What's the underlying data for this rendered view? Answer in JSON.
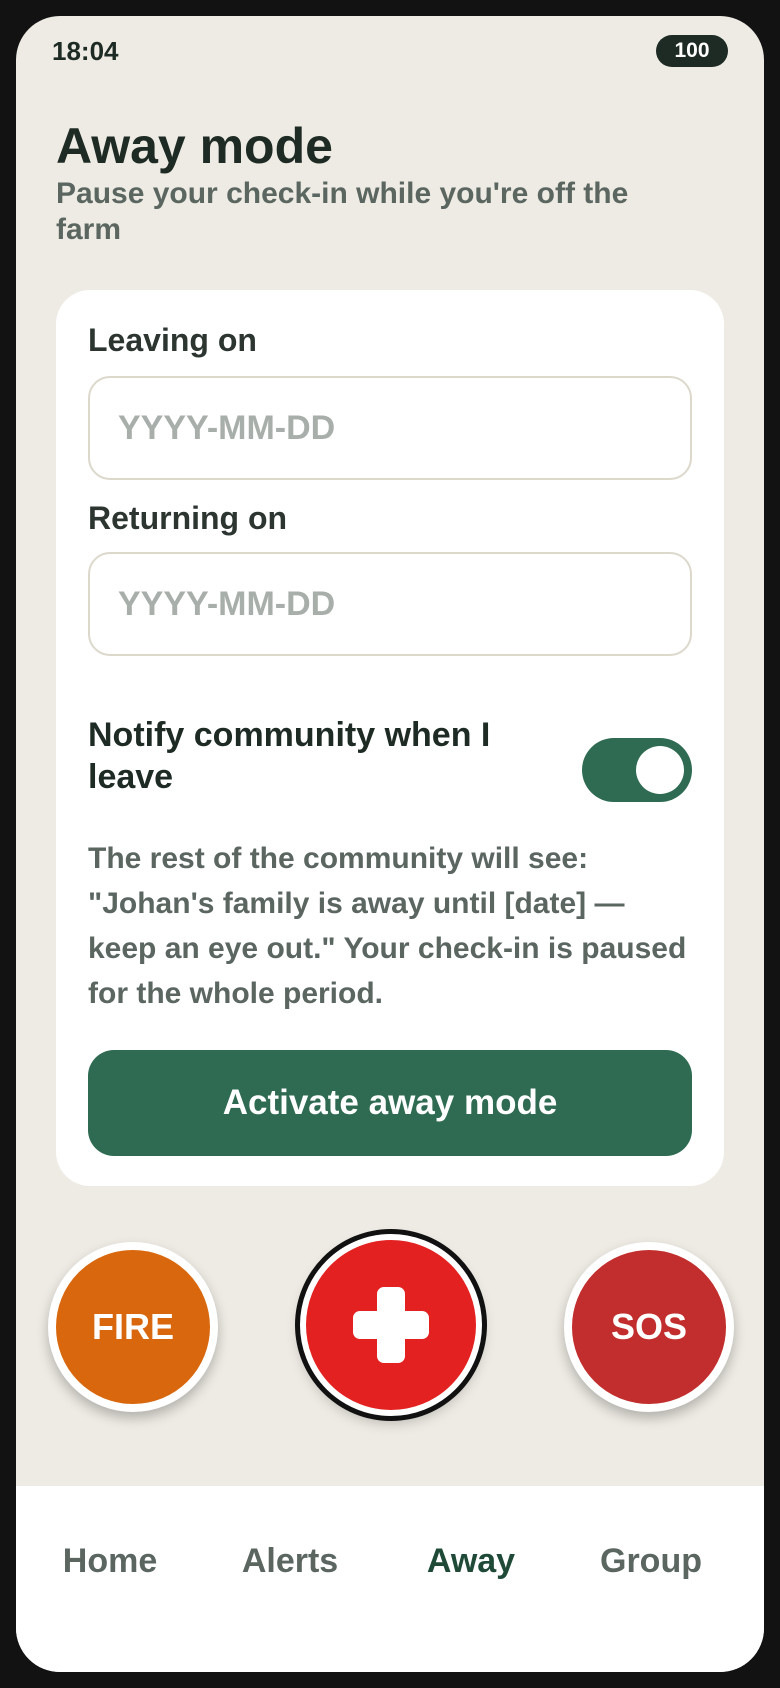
{
  "status_bar": {
    "time": "18:04",
    "battery": "100"
  },
  "header": {
    "title": "Away mode",
    "subtitle": "Pause your check-in while you're off the farm"
  },
  "form": {
    "leaving_label": "Leaving on",
    "leaving_placeholder": "YYYY-MM-DD",
    "leaving_value": "",
    "returning_label": "Returning on",
    "returning_placeholder": "YYYY-MM-DD",
    "returning_value": "",
    "notify_label": "Notify community when I leave",
    "notify_enabled": true,
    "notice": "The rest of the community will see: \"Johan's family is away until [date] — keep an eye out.\" Your check-in is paused for the whole period.",
    "activate_label": "Activate away mode"
  },
  "quick_actions": {
    "fire_label": "FIRE",
    "medical_icon": "medical-cross-icon",
    "sos_label": "SOS"
  },
  "nav": {
    "items": [
      {
        "label": "Home",
        "active": false
      },
      {
        "label": "Alerts",
        "active": false
      },
      {
        "label": "Away",
        "active": true
      },
      {
        "label": "Group",
        "active": false
      }
    ]
  },
  "colors": {
    "background": "#eeebe4",
    "primary_green": "#2e6b52",
    "fire_orange": "#d9670d",
    "medical_red": "#e42121",
    "sos_red": "#c22d2d"
  }
}
